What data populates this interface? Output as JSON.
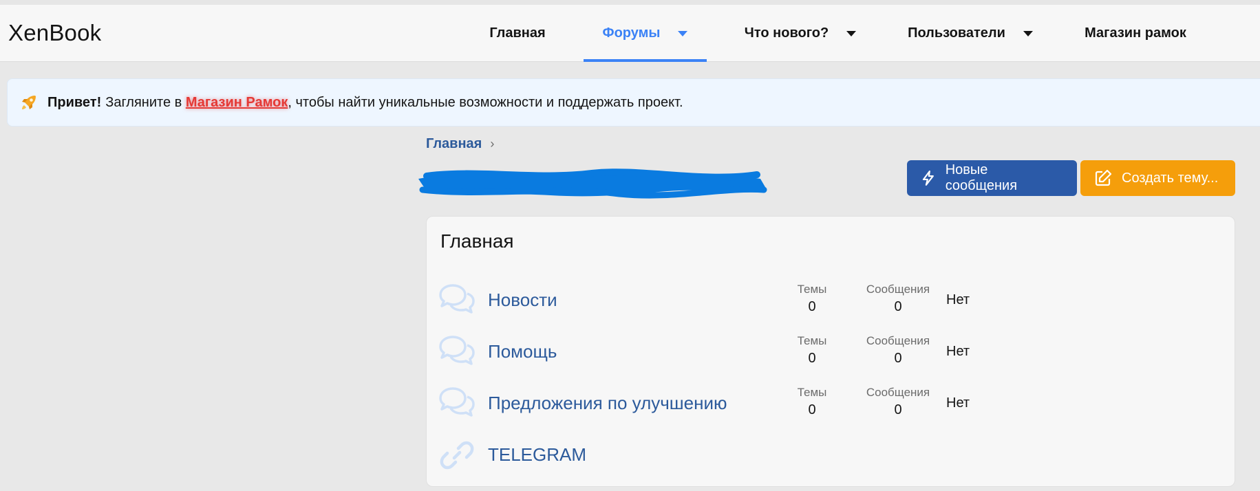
{
  "header": {
    "logo": "XenBook",
    "nav": [
      {
        "label": "Главная",
        "dropdown": false,
        "active": false
      },
      {
        "label": "Форумы",
        "dropdown": true,
        "active": true
      },
      {
        "label": "Что нового?",
        "dropdown": true,
        "active": false
      },
      {
        "label": "Пользователи",
        "dropdown": true,
        "active": false
      },
      {
        "label": "Магазин рамок",
        "dropdown": false,
        "active": false
      }
    ]
  },
  "notice": {
    "icon": "rocket-icon",
    "greeting": "Привет!",
    "text_before": "Загляните в",
    "link": "Магазин Рамок",
    "text_after": ", чтобы найти уникальные возможности и поддержать проект."
  },
  "breadcrumb": {
    "home": "Главная"
  },
  "actions": {
    "new_posts": "Новые сообщения",
    "create_thread": "Создать тему..."
  },
  "category": {
    "title": "Главная",
    "stats_labels": {
      "threads": "Темы",
      "messages": "Сообщения"
    },
    "nodes": [
      {
        "title": "Новости",
        "icon": "forum-chat-icon",
        "threads": "0",
        "messages": "0",
        "last": "Нет"
      },
      {
        "title": "Помощь",
        "icon": "forum-chat-icon",
        "threads": "0",
        "messages": "0",
        "last": "Нет"
      },
      {
        "title": "Предложения по улучшению",
        "icon": "forum-chat-icon",
        "threads": "0",
        "messages": "0",
        "last": "Нет"
      },
      {
        "title": "TELEGRAM",
        "icon": "link-icon"
      }
    ]
  },
  "colors": {
    "accent": "#3b82f6",
    "link": "#2c5a9b",
    "primary_button": "#2b5aa8",
    "create_button": "#f59e0b",
    "notice_link": "#e53935",
    "redaction": "#0a7be0"
  }
}
